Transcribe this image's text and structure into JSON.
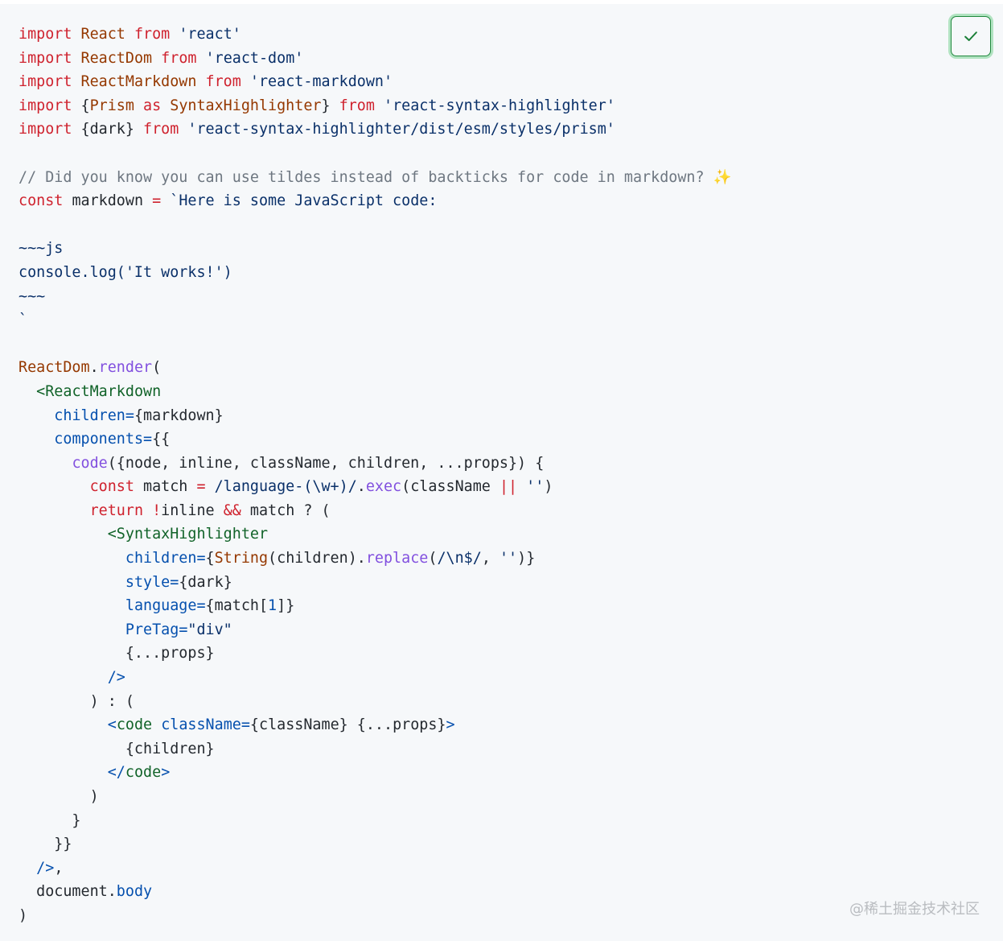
{
  "code": {
    "language": "jsx",
    "lines": [
      [
        [
          "keyword",
          "import "
        ],
        [
          "ident",
          "React "
        ],
        [
          "keyword",
          "from "
        ],
        [
          "string",
          "'react'"
        ]
      ],
      [
        [
          "keyword",
          "import "
        ],
        [
          "ident",
          "ReactDom "
        ],
        [
          "keyword",
          "from "
        ],
        [
          "string",
          "'react-dom'"
        ]
      ],
      [
        [
          "keyword",
          "import "
        ],
        [
          "ident",
          "ReactMarkdown "
        ],
        [
          "keyword",
          "from "
        ],
        [
          "string",
          "'react-markdown'"
        ]
      ],
      [
        [
          "keyword",
          "import "
        ],
        [
          "punct",
          "{"
        ],
        [
          "ident",
          "Prism "
        ],
        [
          "keyword",
          "as "
        ],
        [
          "ident",
          "SyntaxHighlighter"
        ],
        [
          "punct",
          "} "
        ],
        [
          "keyword",
          "from "
        ],
        [
          "string",
          "'react-syntax-highlighter'"
        ]
      ],
      [
        [
          "keyword",
          "import "
        ],
        [
          "punct",
          "{dark} "
        ],
        [
          "keyword",
          "from "
        ],
        [
          "string",
          "'react-syntax-highlighter/dist/esm/styles/prism'"
        ]
      ],
      [],
      [
        [
          "comment",
          "// Did you know you can use tildes instead of backticks for code in markdown? "
        ],
        [
          "emoji",
          "✨"
        ]
      ],
      [
        [
          "keyword",
          "const "
        ],
        [
          "plain",
          "markdown "
        ],
        [
          "keyword",
          "= "
        ],
        [
          "string",
          "`Here is some JavaScript code:"
        ]
      ],
      [],
      [
        [
          "string",
          "~~~js"
        ]
      ],
      [
        [
          "string",
          "console.log('It works!')"
        ]
      ],
      [
        [
          "string",
          "~~~"
        ]
      ],
      [
        [
          "string",
          "`"
        ]
      ],
      [],
      [
        [
          "ident",
          "ReactDom"
        ],
        [
          "plain",
          "."
        ],
        [
          "func",
          "render"
        ],
        [
          "plain",
          "("
        ]
      ],
      [
        [
          "plain",
          "  "
        ],
        [
          "tag",
          "<ReactMarkdown"
        ]
      ],
      [
        [
          "plain",
          "    "
        ],
        [
          "attr",
          "children"
        ],
        [
          "attr",
          "="
        ],
        [
          "plain",
          "{markdown}"
        ]
      ],
      [
        [
          "plain",
          "    "
        ],
        [
          "attr",
          "components"
        ],
        [
          "attr",
          "="
        ],
        [
          "plain",
          "{{"
        ]
      ],
      [
        [
          "plain",
          "      "
        ],
        [
          "func",
          "code"
        ],
        [
          "plain",
          "({node, inline, className, children, ...props}) {"
        ]
      ],
      [
        [
          "plain",
          "        "
        ],
        [
          "keyword",
          "const "
        ],
        [
          "plain",
          "match "
        ],
        [
          "keyword",
          "= "
        ],
        [
          "string",
          "/language-(\\w+)/"
        ],
        [
          "plain",
          "."
        ],
        [
          "func",
          "exec"
        ],
        [
          "plain",
          "(className "
        ],
        [
          "keyword",
          "|| "
        ],
        [
          "string",
          "''"
        ],
        [
          "plain",
          ")"
        ]
      ],
      [
        [
          "plain",
          "        "
        ],
        [
          "keyword",
          "return "
        ],
        [
          "keyword",
          "!"
        ],
        [
          "plain",
          "inline "
        ],
        [
          "keyword",
          "&& "
        ],
        [
          "plain",
          "match ? ("
        ]
      ],
      [
        [
          "plain",
          "          "
        ],
        [
          "tag",
          "<SyntaxHighlighter"
        ]
      ],
      [
        [
          "plain",
          "            "
        ],
        [
          "attr",
          "children"
        ],
        [
          "attr",
          "="
        ],
        [
          "plain",
          "{"
        ],
        [
          "ident",
          "String"
        ],
        [
          "plain",
          "(children)."
        ],
        [
          "func",
          "replace"
        ],
        [
          "plain",
          "("
        ],
        [
          "string",
          "/\\n$/"
        ],
        [
          "plain",
          ", "
        ],
        [
          "string",
          "''"
        ],
        [
          "plain",
          ")}"
        ]
      ],
      [
        [
          "plain",
          "            "
        ],
        [
          "attr",
          "style"
        ],
        [
          "attr",
          "="
        ],
        [
          "plain",
          "{dark}"
        ]
      ],
      [
        [
          "plain",
          "            "
        ],
        [
          "attr",
          "language"
        ],
        [
          "attr",
          "="
        ],
        [
          "plain",
          "{match["
        ],
        [
          "attr",
          "1"
        ],
        [
          "plain",
          "]}"
        ]
      ],
      [
        [
          "plain",
          "            "
        ],
        [
          "attr",
          "PreTag"
        ],
        [
          "attr",
          "="
        ],
        [
          "string",
          "\"div\""
        ]
      ],
      [
        [
          "plain",
          "            {...props}"
        ]
      ],
      [
        [
          "plain",
          "          "
        ],
        [
          "attr",
          "/>"
        ]
      ],
      [
        [
          "plain",
          "        ) : ("
        ]
      ],
      [
        [
          "plain",
          "          "
        ],
        [
          "attr",
          "<"
        ],
        [
          "tag",
          "code "
        ],
        [
          "attr",
          "className"
        ],
        [
          "attr",
          "="
        ],
        [
          "plain",
          "{className} {...props}"
        ],
        [
          "attr",
          ">"
        ]
      ],
      [
        [
          "plain",
          "            {children}"
        ]
      ],
      [
        [
          "plain",
          "          "
        ],
        [
          "attr",
          "</"
        ],
        [
          "tag",
          "code"
        ],
        [
          "attr",
          ">"
        ]
      ],
      [
        [
          "plain",
          "        )"
        ]
      ],
      [
        [
          "plain",
          "      }"
        ]
      ],
      [
        [
          "plain",
          "    }}"
        ]
      ],
      [
        [
          "plain",
          "  "
        ],
        [
          "attr",
          "/>"
        ],
        [
          "plain",
          ","
        ]
      ],
      [
        [
          "plain",
          "  document."
        ],
        [
          "attr",
          "body"
        ]
      ],
      [
        [
          "plain",
          ")"
        ]
      ]
    ]
  },
  "copy_button": {
    "icon": "check-icon",
    "state": "copied",
    "border_color": "#1f883d",
    "icon_color": "#1a7f37"
  },
  "watermark": {
    "text": "@稀土掘金技术社区"
  },
  "colors": {
    "background": "#f6f8fa",
    "keyword": "#cf222e",
    "string": "#0a3069",
    "comment": "#6e7781",
    "function": "#8250df",
    "tag": "#116329",
    "attribute": "#0550ae"
  }
}
